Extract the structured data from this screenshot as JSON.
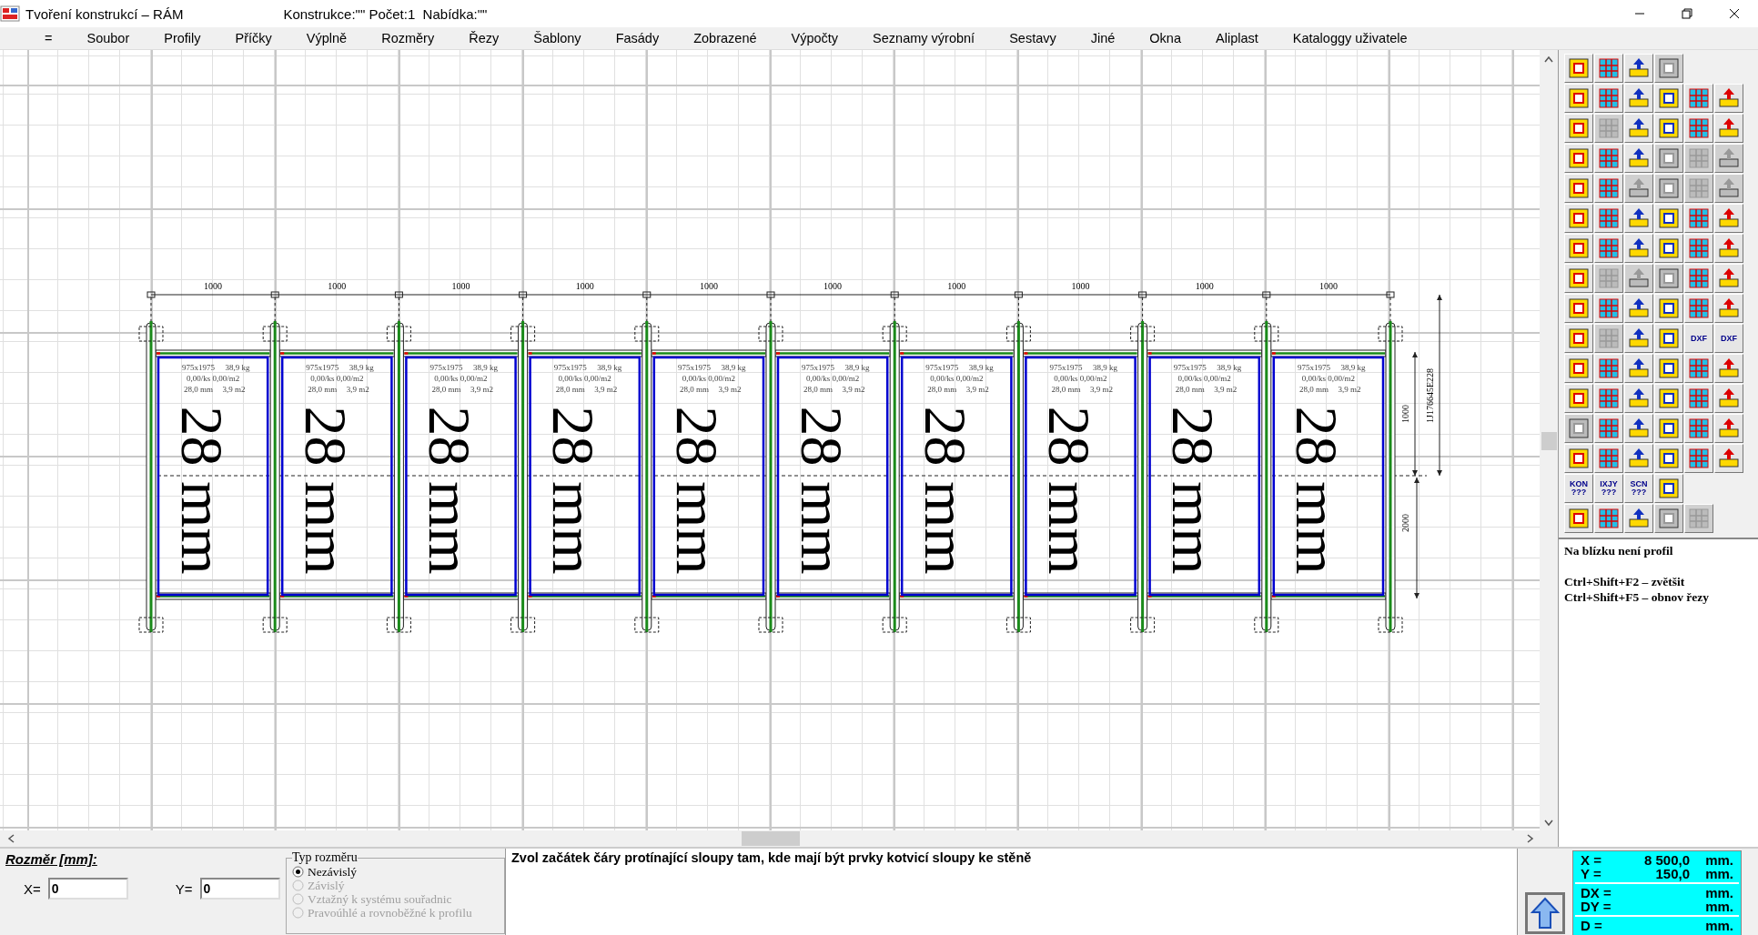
{
  "window": {
    "title": "Tvoření konstrukcí – RÁM",
    "info": "Konstrukce:\"\" Počet:1  Nabídka:\"\""
  },
  "menu": [
    "=",
    "Soubor",
    "Profily",
    "Příčky",
    "Výplně",
    "Rozměry",
    "Řezy",
    "Šablony",
    "Fasády",
    "Zobrazené",
    "Výpočty",
    "Seznamy výrobní",
    "Sestavy",
    "Jiné",
    "Okna",
    "Aliplast",
    "Kataloggy uživatele"
  ],
  "drawing": {
    "panels": [
      {
        "dimension": "1000",
        "size": "975x1975",
        "weight": "38,9 kg",
        "unit_prices": "0,00/ks 0,00/m2",
        "thickness": "28,0 mm",
        "area": "3,9 m2",
        "fill_label": "28 mm"
      },
      {
        "dimension": "1000",
        "size": "975x1975",
        "weight": "38,9 kg",
        "unit_prices": "0,00/ks 0,00/m2",
        "thickness": "28,0 mm",
        "area": "3,9 m2",
        "fill_label": "28 mm"
      },
      {
        "dimension": "1000",
        "size": "975x1975",
        "weight": "38,9 kg",
        "unit_prices": "0,00/ks 0,00/m2",
        "thickness": "28,0 mm",
        "area": "3,9 m2",
        "fill_label": "28 mm"
      },
      {
        "dimension": "1000",
        "size": "975x1975",
        "weight": "38,9 kg",
        "unit_prices": "0,00/ks 0,00/m2",
        "thickness": "28,0 mm",
        "area": "3,9 m2",
        "fill_label": "28 mm"
      },
      {
        "dimension": "1000",
        "size": "975x1975",
        "weight": "38,9 kg",
        "unit_prices": "0,00/ks 0,00/m2",
        "thickness": "28,0 mm",
        "area": "3,9 m2",
        "fill_label": "28 mm"
      },
      {
        "dimension": "1000",
        "size": "975x1975",
        "weight": "38,9 kg",
        "unit_prices": "0,00/ks 0,00/m2",
        "thickness": "28,0 mm",
        "area": "3,9 m2",
        "fill_label": "28 mm"
      },
      {
        "dimension": "1000",
        "size": "975x1975",
        "weight": "38,9 kg",
        "unit_prices": "0,00/ks 0,00/m2",
        "thickness": "28,0 mm",
        "area": "3,9 m2",
        "fill_label": "28 mm"
      },
      {
        "dimension": "1000",
        "size": "975x1975",
        "weight": "38,9 kg",
        "unit_prices": "0,00/ks 0,00/m2",
        "thickness": "28,0 mm",
        "area": "3,9 m2",
        "fill_label": "28 mm"
      },
      {
        "dimension": "1000",
        "size": "975x1975",
        "weight": "38,9 kg",
        "unit_prices": "0,00/ks 0,00/m2",
        "thickness": "28,0 mm",
        "area": "3,9 m2",
        "fill_label": "28 mm"
      },
      {
        "dimension": "1000",
        "size": "975x1975",
        "weight": "38,9 kg",
        "unit_prices": "0,00/ks 0,00/m2",
        "thickness": "28,0 mm",
        "area": "3,9 m2",
        "fill_label": "28 mm"
      }
    ],
    "height_dimensions": [
      "1000",
      "2000"
    ],
    "profile_code": "1J176645E228"
  },
  "toolbar": {
    "rows": [
      [
        {
          "disabled": false
        },
        {
          "disabled": false
        },
        {
          "disabled": false
        },
        {
          "disabled": true
        }
      ],
      [
        {
          "disabled": false
        },
        {
          "disabled": false
        },
        {
          "disabled": false
        },
        {
          "disabled": false
        },
        {
          "disabled": false
        },
        {
          "disabled": false
        }
      ],
      [
        {
          "disabled": false
        },
        {
          "disabled": true
        },
        {
          "disabled": false
        },
        {
          "disabled": false
        },
        {
          "disabled": false
        },
        {
          "disabled": false
        }
      ],
      [
        {
          "disabled": false
        },
        {
          "disabled": false
        },
        {
          "disabled": false
        },
        {
          "disabled": true
        },
        {
          "disabled": true
        },
        {
          "disabled": true
        }
      ],
      [
        {
          "disabled": false
        },
        {
          "disabled": false
        },
        {
          "disabled": true
        },
        {
          "disabled": true
        },
        {
          "disabled": true
        },
        {
          "disabled": true
        }
      ],
      [
        {
          "disabled": false
        },
        {
          "disabled": false
        },
        {
          "disabled": false
        },
        {
          "disabled": false
        },
        {
          "disabled": false
        },
        {
          "disabled": false
        }
      ],
      [
        {
          "disabled": false
        },
        {
          "disabled": false
        },
        {
          "disabled": false
        },
        {
          "disabled": false
        },
        {
          "disabled": false
        },
        {
          "disabled": false
        }
      ],
      [
        {
          "disabled": false
        },
        {
          "disabled": true
        },
        {
          "disabled": true
        },
        {
          "disabled": true
        },
        {
          "disabled": false
        },
        {
          "disabled": false
        }
      ],
      [
        {
          "disabled": false
        },
        {
          "disabled": false
        },
        {
          "disabled": false
        },
        {
          "disabled": false
        },
        {
          "disabled": false
        },
        {
          "disabled": false
        }
      ],
      [
        {
          "disabled": false
        },
        {
          "disabled": true
        },
        {
          "disabled": false
        },
        {
          "disabled": false
        },
        {
          "disabled": false,
          "label": "DXF"
        },
        {
          "disabled": false,
          "label": "DXF"
        }
      ],
      [
        {
          "disabled": false
        },
        {
          "disabled": false
        },
        {
          "disabled": false
        },
        {
          "disabled": false
        },
        {
          "disabled": false
        },
        {
          "disabled": false
        }
      ],
      [
        {
          "disabled": false
        },
        {
          "disabled": false
        },
        {
          "disabled": false
        },
        {
          "disabled": false
        },
        {
          "disabled": false
        },
        {
          "disabled": false
        }
      ],
      [
        {
          "disabled": true
        },
        {
          "disabled": false
        },
        {
          "disabled": false
        },
        {
          "disabled": false
        },
        {
          "disabled": false
        },
        {
          "disabled": false
        }
      ],
      [
        {
          "disabled": false
        },
        {
          "disabled": false
        },
        {
          "disabled": false
        },
        {
          "disabled": false
        },
        {
          "disabled": false
        },
        {
          "disabled": false
        }
      ],
      [
        {
          "disabled": false,
          "label": "KON ???"
        },
        {
          "disabled": false,
          "label": "IXJY ???"
        },
        {
          "disabled": false,
          "label": "SCN ???"
        },
        {
          "disabled": false
        }
      ],
      [
        {
          "disabled": false
        },
        {
          "disabled": false
        },
        {
          "disabled": false
        },
        {
          "disabled": true
        },
        {
          "disabled": true
        }
      ]
    ],
    "messages": [
      "Na blízku není profil",
      "Ctrl+Shift+F2 – zvětšit",
      "Ctrl+Shift+F5 – obnov řezy"
    ]
  },
  "dimension_input": {
    "title": "Rozměr [mm]:",
    "x_label": "X=",
    "x_value": "0",
    "y_label": "Y=",
    "y_value": "0"
  },
  "dimension_type": {
    "title": "Typ rozměru",
    "options": [
      {
        "label": "Nezávislý",
        "selected": true,
        "disabled": false
      },
      {
        "label": "Závislý",
        "selected": false,
        "disabled": true
      },
      {
        "label": "Vztažný k systému souřadnic",
        "selected": false,
        "disabled": true
      },
      {
        "label": "Pravoúhlé a rovnoběžné k profilu",
        "selected": false,
        "disabled": true
      }
    ]
  },
  "prompt": "Zvol začátek čáry protínající sloupy tam, kde mají být prvky kotvicí sloupy ke stěně",
  "coordinates": [
    [
      {
        "label": "X =",
        "value": "8 500,0",
        "unit": "mm."
      },
      {
        "label": "Y =",
        "value": "150,0",
        "unit": "mm."
      }
    ],
    [
      {
        "label": "DX =",
        "unit": "mm."
      },
      {
        "label": "DY =",
        "unit": "mm."
      }
    ],
    [
      {
        "label": "D =",
        "unit": "mm."
      }
    ]
  ]
}
